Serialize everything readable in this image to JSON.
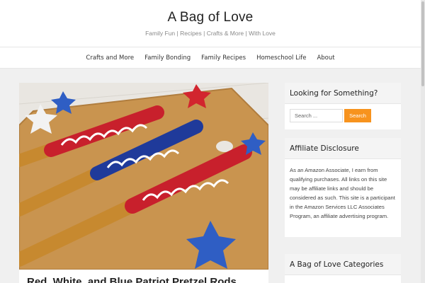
{
  "header": {
    "title": "A Bag of Love",
    "tagline": "Family Fun | Recipes | Crafts & More | With Love"
  },
  "nav": {
    "items": [
      "Crafts and More",
      "Family Bonding",
      "Family Recipes",
      "Homeschool Life",
      "About"
    ]
  },
  "post": {
    "title": "Red, White, and Blue Patriot Pretzel Rods",
    "image_alt": "Red, white and blue candy-coated pretzel rods on a wooden board with glitter stars"
  },
  "sidebar": {
    "search": {
      "title": "Looking for Something?",
      "placeholder": "Search ...",
      "button_label": "Search"
    },
    "disclosure": {
      "title": "Affiliate Disclosure",
      "text": "As an Amazon Associate, I earn from qualifying purchases. All links on this site may be affiliate links and should be considered as such. This site is a participant in the Amazon Services LLC Associates Program, an affiliate advertising program."
    },
    "categories": {
      "title": "A Bag of Love Categories"
    }
  },
  "colors": {
    "accent": "#f7931e",
    "page_background": "#f0f0f0"
  }
}
